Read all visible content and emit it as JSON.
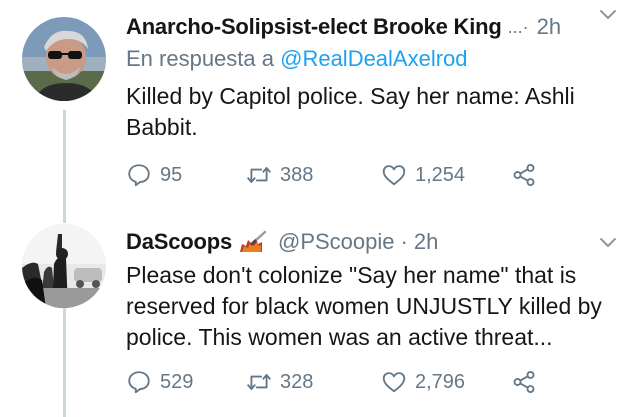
{
  "tweets": [
    {
      "author_name": "Anarcho-Solipsist-elect Brooke King",
      "ellipsis": "...·",
      "time": "2h",
      "reply_prefix": "En respuesta a",
      "reply_mention": "@RealDealAxelrod",
      "text": "Killed by Capitol police. Say her name: Ashli Babbit.",
      "replies": "95",
      "retweets": "388",
      "likes": "1,254"
    },
    {
      "author_name": "DaScoops",
      "handle": "@PScoopie",
      "separator": "·",
      "time": "2h",
      "text": "Please don't colonize \"Say her name\" that is reserved for black women UNJUSTLY killed by police. This women was an active threat...",
      "replies": "529",
      "retweets": "328",
      "likes": "2,796"
    }
  ],
  "colors": {
    "text_primary": "#14171a",
    "text_secondary": "#657786",
    "link": "#1da1f2",
    "thread_line": "#ccd6dd"
  },
  "icons": {
    "reply": "reply-bubble-icon",
    "retweet": "retweet-icon",
    "like": "heart-icon",
    "share": "share-icon",
    "menu": "chevron-down-icon",
    "badge": "paint-brush-emoji-icon"
  }
}
